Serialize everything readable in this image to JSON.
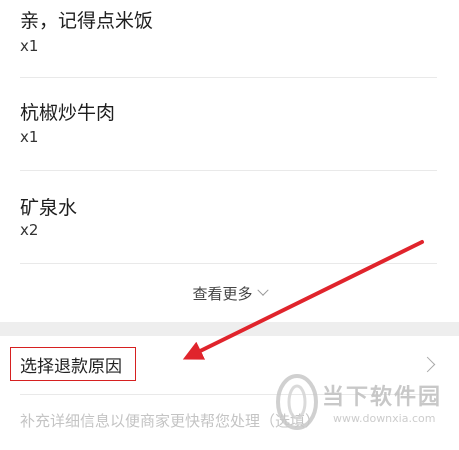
{
  "order_items": [
    {
      "name": "亲，记得点米饭",
      "qty": "x1"
    },
    {
      "name": "杭椒炒牛肉",
      "qty": "x1"
    },
    {
      "name": "矿泉水",
      "qty": "x2"
    }
  ],
  "more_label": "查看更多",
  "refund": {
    "reason_label": "选择退款原因",
    "supplement_placeholder": "补充详细信息以便商家更快帮您处理（选填）"
  },
  "watermark": {
    "text": "当下软件园",
    "url": "www.downxia.com"
  },
  "colors": {
    "highlight_red": "#d62020",
    "arrow_red": "#e0242c"
  }
}
